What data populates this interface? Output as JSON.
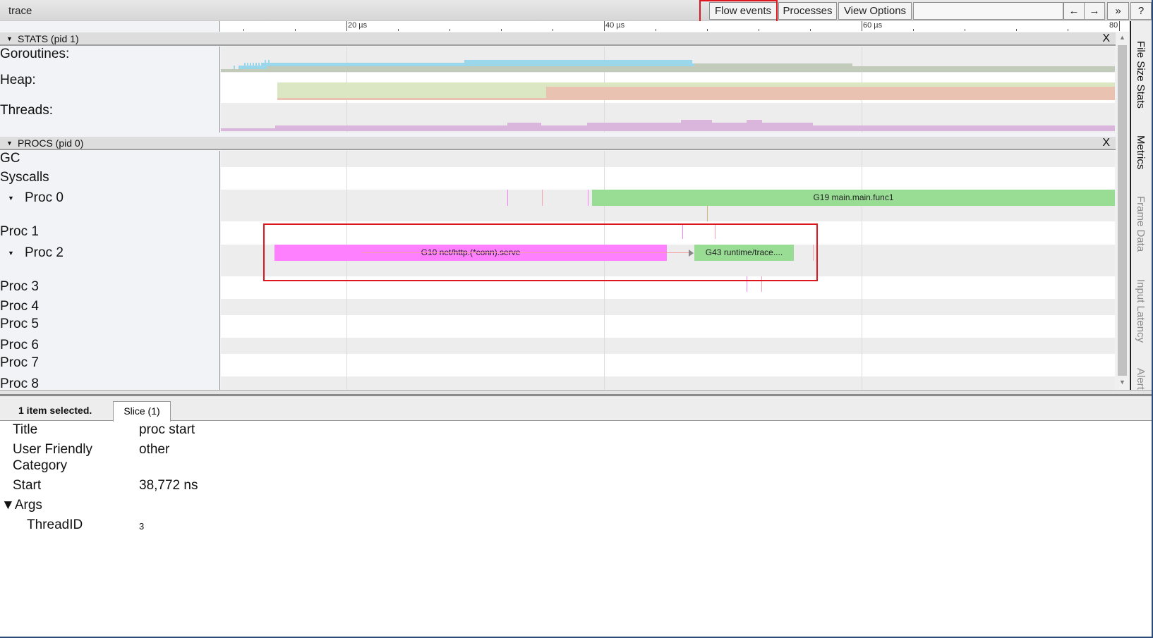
{
  "app": {
    "title": "trace"
  },
  "toolbar": {
    "flow_events": "Flow events",
    "processes": "Processes",
    "view_options": "View Options",
    "search_value": "",
    "prev_label": "←",
    "next_label": "→",
    "expand_label": "»",
    "help_label": "?"
  },
  "ruler": {
    "unit": "µs",
    "major_ticks": [
      "20 µs",
      "40 µs",
      "60 µs",
      "80"
    ]
  },
  "stats": {
    "header": "STATS (pid 1)",
    "close": "X",
    "rows": [
      {
        "label": "Goroutines:"
      },
      {
        "label": "Heap:"
      },
      {
        "label": "Threads:"
      }
    ],
    "colors": {
      "goroutines_running": "#9bd7ea",
      "goroutines_runnable": "#c2cbba",
      "heap_alloc": "#dae7c2",
      "heap_next_gc": "#e9c2b1",
      "threads": "#dbb6dc"
    }
  },
  "procs": {
    "header": "PROCS (pid 0)",
    "close": "X",
    "rows": [
      {
        "label": "GC"
      },
      {
        "label": "Syscalls"
      },
      {
        "label": "Proc 0",
        "expanded": true
      },
      {
        "label": "Proc 1"
      },
      {
        "label": "Proc 2",
        "expanded": true
      },
      {
        "label": "Proc 3"
      },
      {
        "label": "Proc 4"
      },
      {
        "label": "Proc 5"
      },
      {
        "label": "Proc 6"
      },
      {
        "label": "Proc 7"
      },
      {
        "label": "Proc 8"
      }
    ],
    "slices": [
      {
        "name": "G19 main.main.func1",
        "proc": "Proc 0",
        "color": "#99dd95"
      },
      {
        "name": "G10 net/http.(*conn).serve",
        "proc": "Proc 2",
        "color": "#ff80ff"
      },
      {
        "name": "G43 runtime/trace....",
        "proc": "Proc 2",
        "color": "#99dd95"
      }
    ]
  },
  "side_tabs": [
    "File Size Stats",
    "Metrics",
    "Frame Data",
    "Input Latency",
    "Alerts"
  ],
  "selection": {
    "count_label": "1 item selected.",
    "tab_label": "Slice (1)",
    "fields": [
      {
        "key": "Title",
        "value": "proc start"
      },
      {
        "key": "User Friendly Category",
        "value": "other"
      },
      {
        "key": "Start",
        "value": "38,772 ns"
      }
    ],
    "args_label": "Args",
    "args": [
      {
        "key": "ThreadID",
        "value": "3"
      }
    ]
  }
}
